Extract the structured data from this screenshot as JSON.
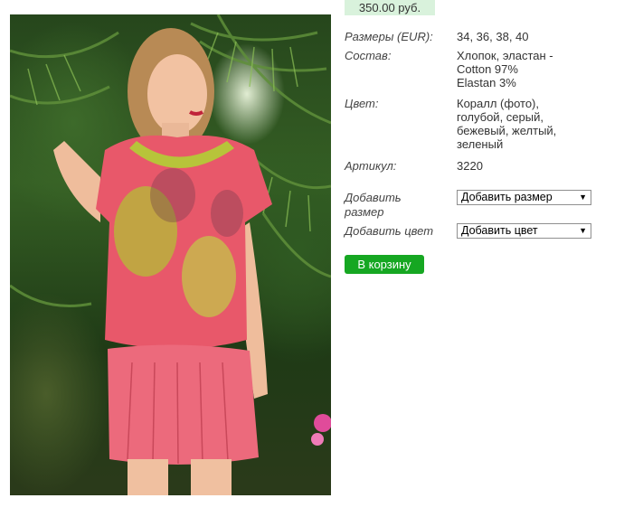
{
  "product": {
    "price": "350.00 руб.",
    "image_alt": "product photo: model in coral printed blouse and pleated skirt",
    "attributes": [
      {
        "label": "Размеры (EUR):",
        "value": [
          "34, 36, 38, 40"
        ]
      },
      {
        "label": "Состав:",
        "value": [
          "Хлопок, эластан -",
          "Cotton 97%",
          "Elastan 3%"
        ]
      },
      {
        "label": "Цвет:",
        "value": [
          "Коралл (фото),",
          "голубой, серый,",
          "бежевый, желтый,",
          "зеленый"
        ]
      },
      {
        "label": "Артикул:",
        "value": [
          "3220"
        ]
      }
    ]
  },
  "options": {
    "size_label": [
      "Добавить",
      "размер"
    ],
    "size_select": "Добавить размер",
    "color_label": "Добавить цвет",
    "color_select": "Добавить цвет"
  },
  "actions": {
    "cart_label": "В корзину"
  },
  "colors": {
    "price_bg": "#d9f2dc",
    "cart_bg": "#16a722",
    "blouse_coral": "#e8586a",
    "skirt_pink": "#ec6a7c",
    "foliage_green": "#2f5a22"
  },
  "icons": {
    "dropdown": "▼"
  }
}
